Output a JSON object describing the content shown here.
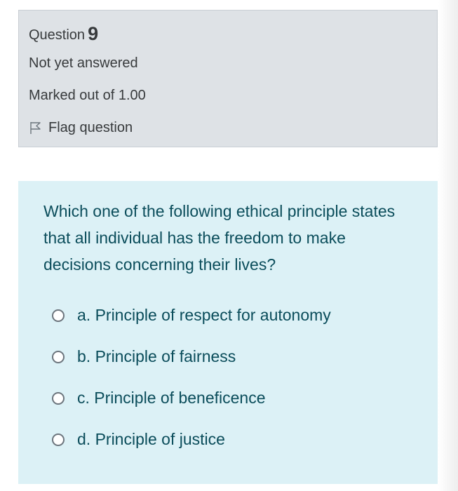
{
  "info": {
    "question_label": "Question",
    "question_number": "9",
    "state": "Not yet answered",
    "grade": "Marked out of 1.00",
    "flag_label": "Flag question"
  },
  "question": {
    "text": "Which one of the following ethical principle states that all individual has the freedom to make decisions concerning their lives?",
    "answers": [
      {
        "label": "a. Principle of respect for autonomy",
        "selected": false
      },
      {
        "label": "b. Principle of fairness",
        "selected": false
      },
      {
        "label": "c. Principle of beneficence",
        "selected": false
      },
      {
        "label": "d. Principle of justice",
        "selected": false
      }
    ]
  },
  "icons": {
    "flag": "flag-icon"
  }
}
